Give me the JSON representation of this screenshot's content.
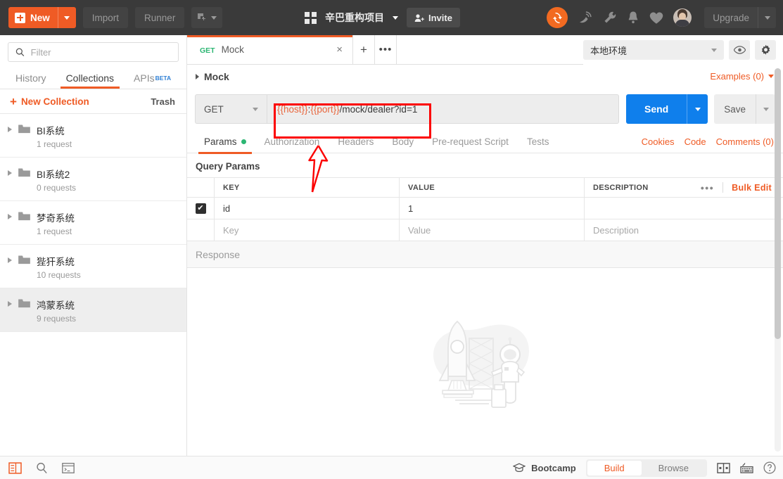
{
  "topbar": {
    "new_label": "New",
    "import_label": "Import",
    "runner_label": "Runner",
    "workspace_name": "辛巴重构项目",
    "invite_label": "Invite",
    "upgrade_label": "Upgrade",
    "icons": {
      "new_plus": "plus-icon",
      "new_caret": "chevron-down-icon",
      "open_new": "open-new-window-icon",
      "grid": "apps-grid-icon",
      "invite": "person-add-icon",
      "sync": "sync-icon",
      "satellite": "satellite-antenna-icon",
      "wrench": "wrench-icon",
      "bell": "bell-icon",
      "heart": "heart-icon",
      "avatar": "user-avatar"
    },
    "accent": "#ef5b25",
    "bg": "#3a3a3a"
  },
  "sidebar": {
    "filter_placeholder": "Filter",
    "tabs": [
      {
        "label": "History",
        "active": false
      },
      {
        "label": "Collections",
        "active": true
      },
      {
        "label": "APIs",
        "badge": "BETA",
        "active": false
      }
    ],
    "new_collection_label": "New Collection",
    "trash_label": "Trash",
    "collections": [
      {
        "name": "BI系统",
        "count": "1 request",
        "selected": false
      },
      {
        "name": "BI系统2",
        "count": "0 requests",
        "selected": false
      },
      {
        "name": "梦奇系统",
        "count": "1 request",
        "selected": false
      },
      {
        "name": "狴犴系统",
        "count": "10 requests",
        "selected": false
      },
      {
        "name": "鸿蒙系统",
        "count": "9 requests",
        "selected": true
      }
    ]
  },
  "main": {
    "tab": {
      "method": "GET",
      "title": "Mock",
      "close": "×",
      "add": "+",
      "more": "•••"
    },
    "environment": {
      "selected": "本地环境"
    },
    "breadcrumb": "Mock",
    "examples_label": "Examples (0)",
    "request": {
      "method": "GET",
      "url_full": "{{host}}:{{port}}/mock/dealer?id=1",
      "url_parts": [
        {
          "text": "{{host}}",
          "variable": true
        },
        {
          "text": ":",
          "variable": false
        },
        {
          "text": "{{port}}",
          "variable": true
        },
        {
          "text": "/mock/dealer?id=1",
          "variable": false
        }
      ],
      "send_label": "Send",
      "save_label": "Save"
    },
    "req_tabs": [
      {
        "label": "Params",
        "active": true,
        "dot": true
      },
      {
        "label": "Authorization",
        "active": false,
        "dot": false
      },
      {
        "label": "Headers",
        "active": false,
        "dot": false
      },
      {
        "label": "Body",
        "active": false,
        "dot": false
      },
      {
        "label": "Pre-request Script",
        "active": false,
        "dot": false
      },
      {
        "label": "Tests",
        "active": false,
        "dot": false
      }
    ],
    "right_links": [
      "Cookies",
      "Code",
      "Comments (0)"
    ],
    "query_params": {
      "section_title": "Query Params",
      "headers": [
        "KEY",
        "VALUE",
        "DESCRIPTION"
      ],
      "bulk_edit_label": "Bulk Edit",
      "more_label": "•••",
      "rows": [
        {
          "checked": true,
          "key": "id",
          "value": "1",
          "description": ""
        }
      ],
      "placeholder_row": {
        "key": "Key",
        "value": "Value",
        "description": "Description"
      }
    },
    "response": {
      "title": "Response",
      "illustration": "rocket-astronaut-illustration"
    }
  },
  "statusbar": {
    "bootcamp_label": "Bootcamp",
    "toggle": [
      {
        "label": "Build",
        "active": true
      },
      {
        "label": "Browse",
        "active": false
      }
    ],
    "icons": {
      "sidebar_toggle": "sidebar-toggle-icon",
      "find": "search-icon",
      "console": "console-icon",
      "two_pane": "two-pane-layout-icon",
      "keyboard": "keyboard-shortcuts-icon",
      "help": "help-circle-icon"
    }
  },
  "annotations": {
    "highlight_box": {
      "target": "url-input",
      "color": "#fc0000"
    },
    "arrow": {
      "points_to": "url-input",
      "color": "#fc0000"
    }
  }
}
